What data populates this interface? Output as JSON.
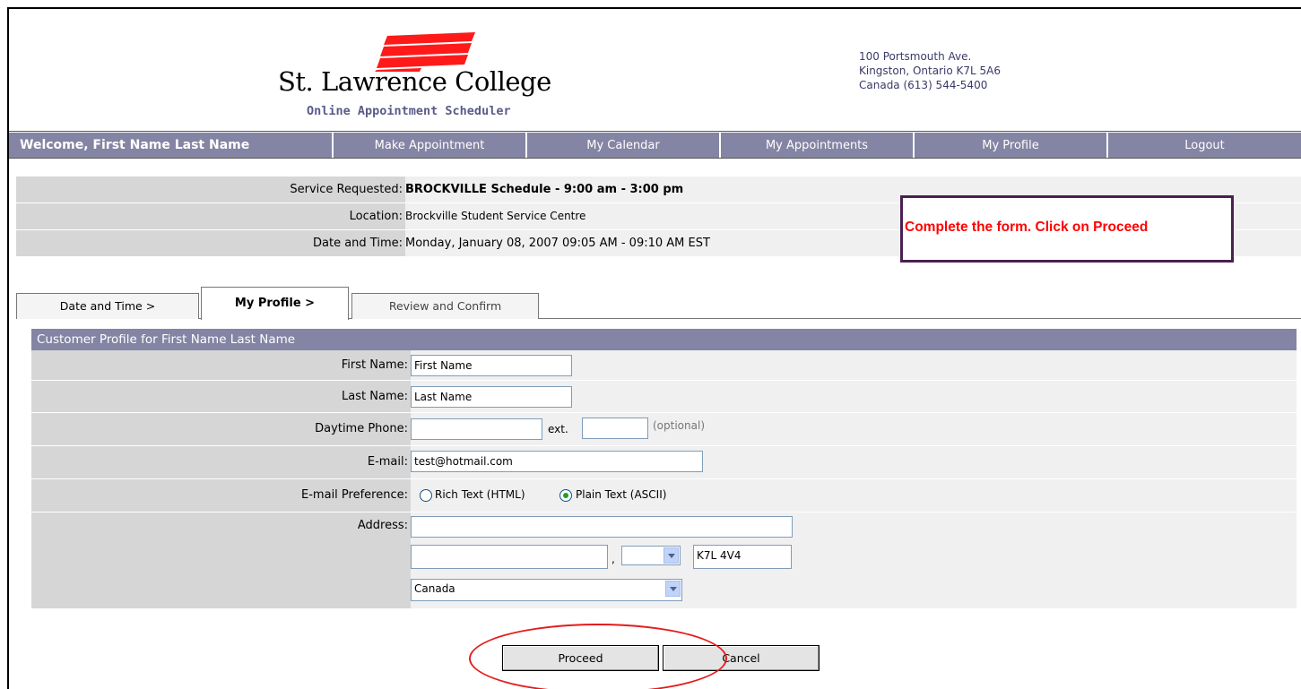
{
  "header": {
    "college_name": "St. Lawrence College",
    "college_subtitle": "Online Appointment Scheduler",
    "address_line1": "100 Portsmouth Ave.",
    "address_line2": "Kingston, Ontario K7L 5A6",
    "address_line3": "Canada  (613) 544-5400",
    "logo_color": "#ff1a1a"
  },
  "nav": {
    "welcome": "Welcome, First Name Last Name",
    "items": [
      "Make Appointment",
      "My Calendar",
      "My Appointments",
      "My Profile",
      "Logout"
    ],
    "color": "#8484a4"
  },
  "info": {
    "service_label": "Service Requested:",
    "service_value": "BROCKVILLE Schedule - 9:00 am - 3:00 pm",
    "location_label": "Location:",
    "location_value": "Brockville Student Service Centre",
    "datetime_label": "Date and Time:",
    "datetime_value": "Monday, January 08, 2007 09:05 AM - 09:10 AM EST"
  },
  "callout": {
    "text": "Complete the form.  Click on Proceed",
    "color": "#ff0000"
  },
  "tabs": [
    "Date and Time >",
    "My Profile >",
    "Review and Confirm"
  ],
  "form": {
    "title": "Customer Profile for First Name Last Name",
    "first_name_label": "First Name:",
    "first_name_value": "First Name",
    "last_name_label": "Last Name:",
    "last_name_value": "Last Name",
    "phone_label": "Daytime Phone:",
    "phone_value": "",
    "ext_label": "ext.",
    "ext_value": "",
    "optional_note": "(optional)",
    "email_label": "E-mail:",
    "email_value": "test@hotmail.com",
    "email_pref_label": "E-mail Preference:",
    "pref_rich": "Rich Text (HTML)",
    "pref_plain": "Plain Text (ASCII)",
    "pref_selected": "Plain Text (ASCII)",
    "address_label": "Address:",
    "address_line": "",
    "city": "",
    "city_separator": ",",
    "province": "",
    "postal_code": "K7L 4V4",
    "country": "Canada"
  },
  "buttons": {
    "proceed": "Proceed",
    "cancel": "Cancel"
  },
  "annotation_color": "#e41c1c"
}
